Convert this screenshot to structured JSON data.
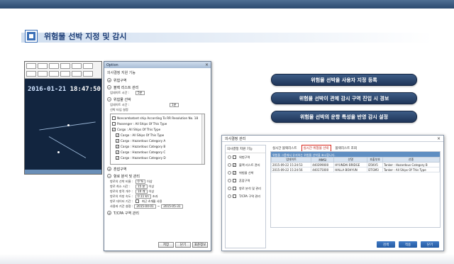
{
  "slide": {
    "title": "위험물 선박 지정 및 감시"
  },
  "features": [
    "위험물 선박을 사용자 지정 등록",
    "위험물 선박이 관제 감시 구역 진입 시 경보",
    "위험물 선박의 운항 특성을 반영 감시 설정"
  ],
  "radar": {
    "date": "2016-01-21",
    "time": "18:47:50"
  },
  "option_dialog": {
    "title": "Option",
    "header": "의사결정 지원 기능",
    "sections": {
      "s1": "위험구역",
      "s2": "블랙 리스트 관리",
      "s3": "위험물 선박",
      "s4": "혼잡구역",
      "s5": "항로 분석 및 관리",
      "s6": "T/CPA 구역 관리"
    },
    "blacklist_time_label": "업데이트 시간 :",
    "blacklist_time_value": "5분",
    "hazard_time_label": "업데이트 시간 :",
    "hazard_time_value": "1분",
    "ship_type_label": "선박 타입 설정",
    "ship_types": [
      {
        "label": "Noncombatant ship According To RR Resolution No. 18",
        "checked": false,
        "indent": false
      },
      {
        "label": "Passenger : All Ships Of This Type",
        "checked": false,
        "indent": false
      },
      {
        "label": "Cargo : All Ships Of This Type",
        "checked": true,
        "indent": false
      },
      {
        "label": "Cargo : All Ships Of This Type",
        "checked": true,
        "indent": true
      },
      {
        "label": "Cargo : Hazardous Category A",
        "checked": true,
        "indent": true
      },
      {
        "label": "Cargo : Hazardous Category B",
        "checked": true,
        "indent": true
      },
      {
        "label": "Cargo : Hazardous Category C",
        "checked": true,
        "indent": true
      },
      {
        "label": "Cargo : Hazardous Category D",
        "checked": true,
        "indent": true
      }
    ],
    "route_rows": [
      {
        "label": "항로의 선박 비율 :",
        "value": "0 %",
        "unit": "이상"
      },
      {
        "label": "항로 최소 시간 :",
        "value": "15 분",
        "unit": "이상"
      },
      {
        "label": "항로의 항적 개수 :",
        "value": "10 개",
        "unit": "이상"
      },
      {
        "label": "항로의 허방 속도 :",
        "value": "0.11 kn",
        "unit": "초과"
      },
      {
        "label": "항로 데이터 기간 :",
        "value": "",
        "unit": "최근 4개월 사용"
      }
    ],
    "period_label": "사용자 기간 설정 :",
    "period_from": "2015-04-01",
    "period_to": "2015-05-31",
    "buttons": {
      "save": "저장",
      "close": "닫기",
      "default": "표준정보"
    }
  },
  "decision_panel": {
    "title": "의사결정 관리",
    "left_header": "의사결정 지원 기능",
    "left_items": [
      {
        "label": "위험구역",
        "checked": false
      },
      {
        "label": "블랙 리스트 관리",
        "checked": true
      },
      {
        "label": "위험물 선박",
        "checked": true
      },
      {
        "label": "혼잡구역",
        "checked": false
      },
      {
        "label": "항로 분석 및 관리",
        "checked": false
      },
      {
        "label": "T/CPA 구역 관리",
        "checked": false
      }
    ],
    "tabs": [
      "실시간 블랙리스트",
      "실시간 위험물 선박",
      "블랙리스트 조회"
    ],
    "active_tab": 1,
    "info_bar": "위험물 그룹에서 유지하는 위험물 선박을 표시합니다.",
    "columns": [
      "업데이트",
      "MMSI",
      "선명",
      "호출부호",
      "선종"
    ],
    "rows": [
      [
        "2015-09-22 15:24:53",
        "440399000",
        "HYUNDAI BRIDGE",
        "D5KV5",
        "Tanker : Hazardous Category B"
      ],
      [
        "2015-09-22 15:24:56",
        "440175000",
        "HALLA BOHYUN",
        "DTGM3",
        "Tanker : All Ships Of This Type"
      ]
    ],
    "buttons": {
      "search": "검색",
      "apply": "적용",
      "close": "닫기"
    }
  }
}
